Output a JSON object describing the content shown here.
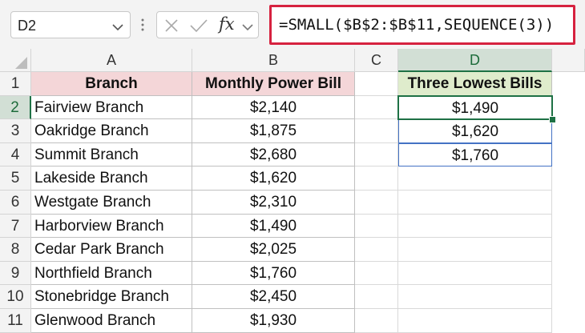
{
  "name_box": "D2",
  "fx_label": "fx",
  "formula": "=SMALL($B$2:$B$11,SEQUENCE(3))",
  "columns": [
    "A",
    "B",
    "C",
    "D"
  ],
  "rows": [
    "1",
    "2",
    "3",
    "4",
    "5",
    "6",
    "7",
    "8",
    "9",
    "10",
    "11"
  ],
  "headers": {
    "branch": "Branch",
    "bill": "Monthly Power Bill",
    "lowest": "Three Lowest Bills"
  },
  "data": [
    {
      "branch": "Fairview Branch",
      "bill": "$2,140"
    },
    {
      "branch": "Oakridge Branch",
      "bill": "$1,875"
    },
    {
      "branch": "Summit Branch",
      "bill": "$2,680"
    },
    {
      "branch": "Lakeside Branch",
      "bill": "$1,620"
    },
    {
      "branch": "Westgate Branch",
      "bill": "$2,310"
    },
    {
      "branch": "Harborview Branch",
      "bill": "$1,490"
    },
    {
      "branch": "Cedar Park Branch",
      "bill": "$2,025"
    },
    {
      "branch": "Northfield Branch",
      "bill": "$1,760"
    },
    {
      "branch": "Stonebridge Branch",
      "bill": "$2,450"
    },
    {
      "branch": "Glenwood Branch",
      "bill": "$1,930"
    }
  ],
  "results": [
    "$1,490",
    "$1,620",
    "$1,760"
  ],
  "colors": {
    "accent_green": "#1e7145",
    "formula_highlight": "#d6223f",
    "header_pink": "#f4d6d8",
    "header_green": "#dfeccc",
    "result_border": "#4472c4"
  }
}
